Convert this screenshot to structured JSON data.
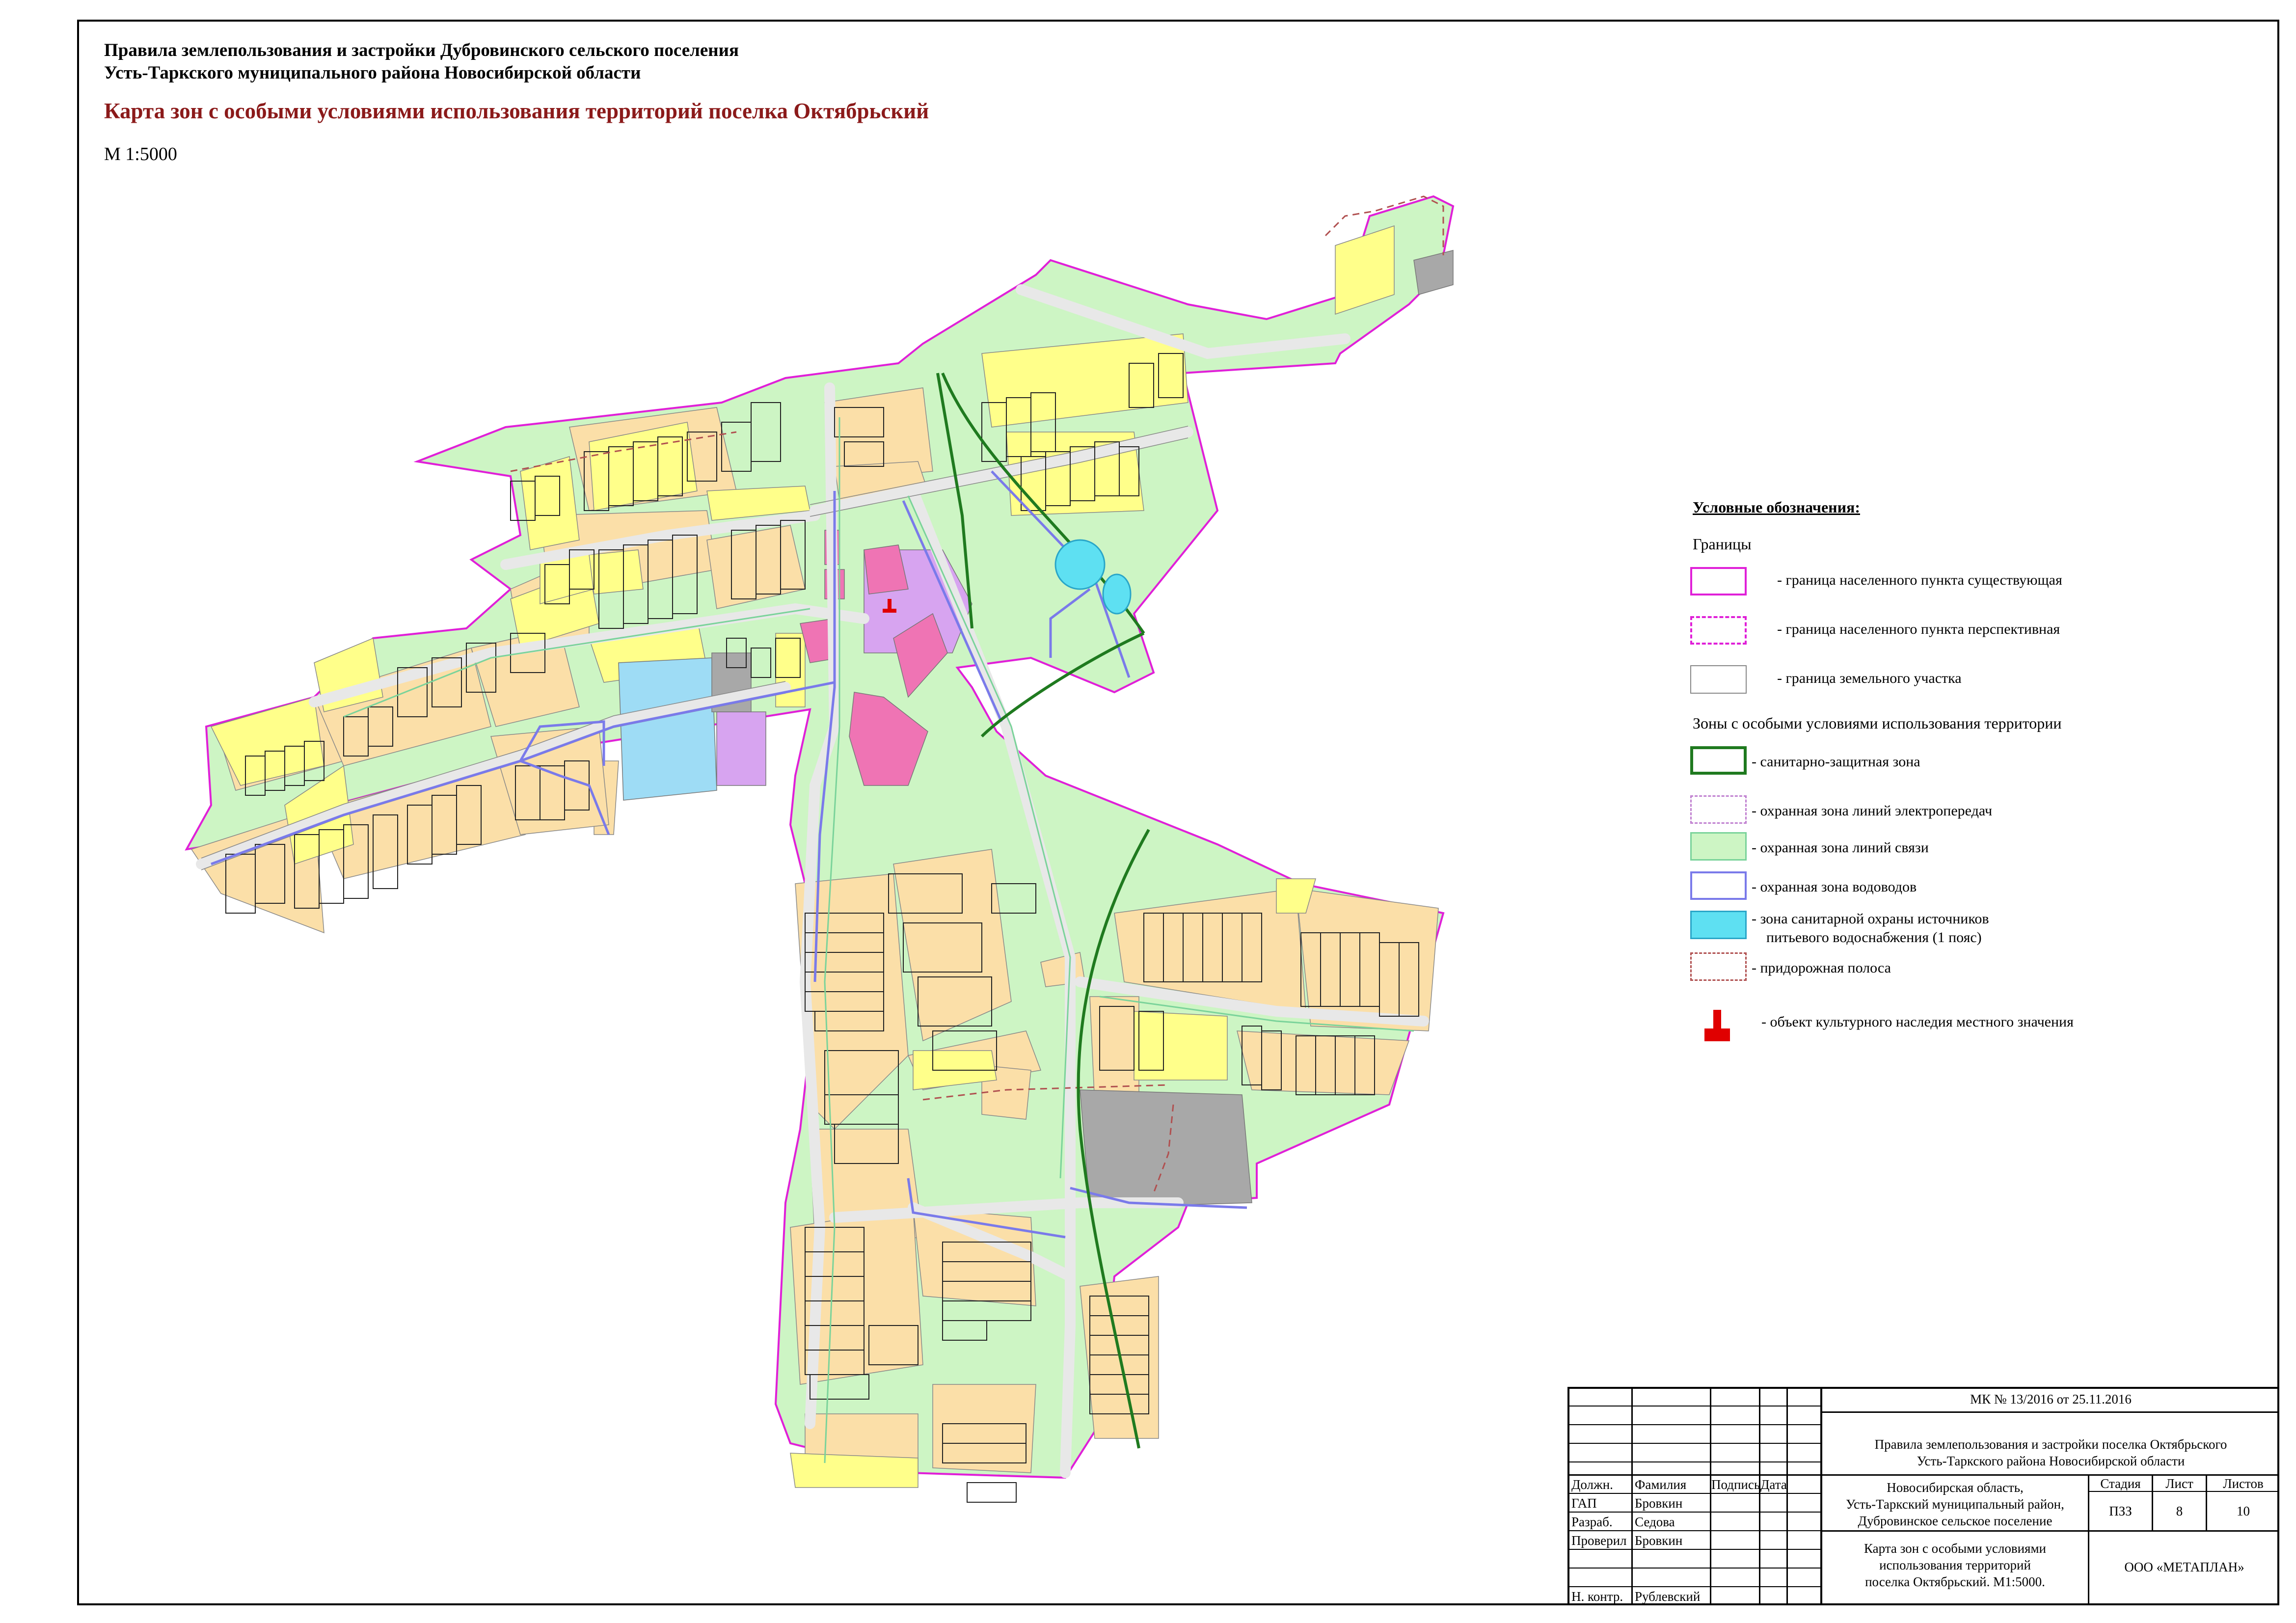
{
  "header": {
    "line1": "Правила землепользования и застройки Дубровинского сельского поселения",
    "line2": "Усть-Таркского муниципального района Новосибирской области",
    "map_title": "Карта зон с особыми условиями использования территорий поселка Октябрьский",
    "scale": "М 1:5000"
  },
  "legend": {
    "title": "Условные обозначения:",
    "section_borders": "Границы",
    "border_existing": "- граница населенного пункта существующая",
    "border_planned": "- граница населенного пункта перспективная",
    "border_parcel": "- граница земельного участка",
    "section_zones": "Зоны с особыми условиями использования территории",
    "zone_sanitary": "- санитарно-защитная зона",
    "zone_power": "- охранная зона линий электропередач",
    "zone_comm": "- охранная зона линий связи",
    "zone_water": "- охранная зона водоводов",
    "zone_source_1": "- зона санитарной охраны источников",
    "zone_source_2": "питьевого водоснабжения (1 пояс)",
    "zone_road": "- придорожная полоса",
    "heritage": "- объект культурного наследия местного значения"
  },
  "colors": {
    "border": "#e020d8",
    "residential_orange": "#fbdfa8",
    "residential_yellow": "#ffff8a",
    "green": "#cdf5c4",
    "pink": "#ef74b4",
    "violet": "#d7a4f0",
    "blue": "#9edcf5",
    "grey": "#a8a8a8",
    "road": "#e8e8e8",
    "sanitary": "#1f7a1f",
    "water": "#7a7aea",
    "source": "#34d8ee",
    "heritage": "#e00000",
    "title_red": "#8b1a1a"
  },
  "stamp": {
    "doc_number": "МК № 13/2016 от 25.11.2016",
    "project_1": "Правила землепользования и застройки поселка Октябрьского",
    "project_2": "Усть-Таркского района Новосибирской области",
    "col_position": "Должн.",
    "col_name": "Фамилия",
    "col_sign": "Подпись",
    "col_date": "Дата",
    "rows": [
      {
        "position": "ГАП",
        "name": "Бровкин"
      },
      {
        "position": "Разраб.",
        "name": "Седова"
      },
      {
        "position": "Проверил",
        "name": "Бровкин"
      }
    ],
    "control_position": "Н. контр.",
    "control_name": "Рублевский",
    "location_1": "Новосибирская область,",
    "location_2": "Усть-Таркский муниципальный район,",
    "location_3": "Дубровинское сельское поселение",
    "stage_label": "Стадия",
    "sheet_label": "Лист",
    "sheets_label": "Листов",
    "stage": "ПЗЗ",
    "sheet": "8",
    "sheets": "10",
    "sheet_title_1": "Карта зон с особыми условиями",
    "sheet_title_2": "использования территорий",
    "sheet_title_3": "поселка Октябрьский. М1:5000.",
    "company": "ООО «МЕТАПЛАН»"
  }
}
